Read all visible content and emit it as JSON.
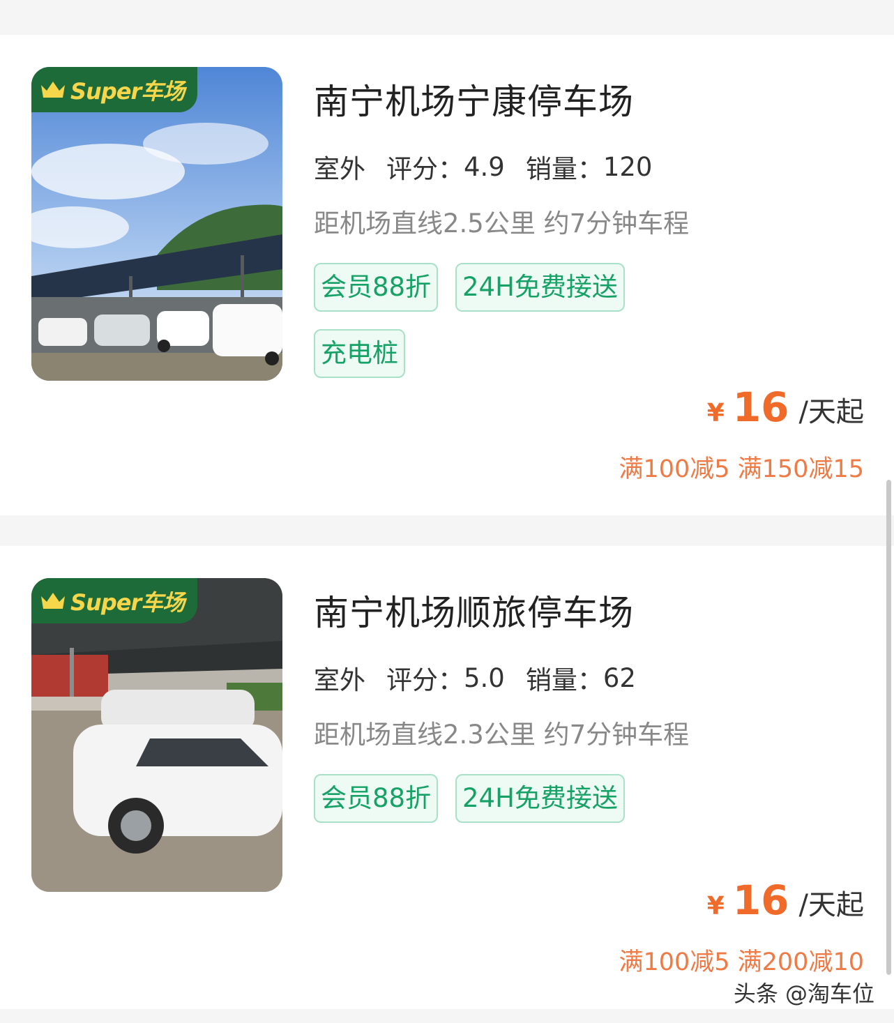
{
  "listings": [
    {
      "badge": "Super车场",
      "title": "南宁机场宁康停车场",
      "type": "室外",
      "rating_label": "评分：",
      "rating": "4.9",
      "sales_label": "销量：",
      "sales": "120",
      "distance": "距机场直线2.5公里 约7分钟车程",
      "tags": [
        "会员88折",
        "24H免费接送",
        "充电桩"
      ],
      "currency": "¥",
      "price": "16",
      "price_unit": "/天起",
      "promo": "满100减5 满150减15"
    },
    {
      "badge": "Super车场",
      "title": "南宁机场顺旅停车场",
      "type": "室外",
      "rating_label": "评分：",
      "rating": "5.0",
      "sales_label": "销量：",
      "sales": "62",
      "distance": "距机场直线2.3公里 约7分钟车程",
      "tags": [
        "会员88折",
        "24H免费接送"
      ],
      "currency": "¥",
      "price": "16",
      "price_unit": "/天起",
      "promo": "满100减5 满200减10"
    }
  ],
  "watermark": "头条 @淘车位",
  "colors": {
    "accent_green": "#16a266",
    "price_orange": "#f06a2a",
    "badge_green": "#1e6b3a",
    "badge_gold": "#f6d64a"
  },
  "icons": [
    "crown-icon"
  ]
}
